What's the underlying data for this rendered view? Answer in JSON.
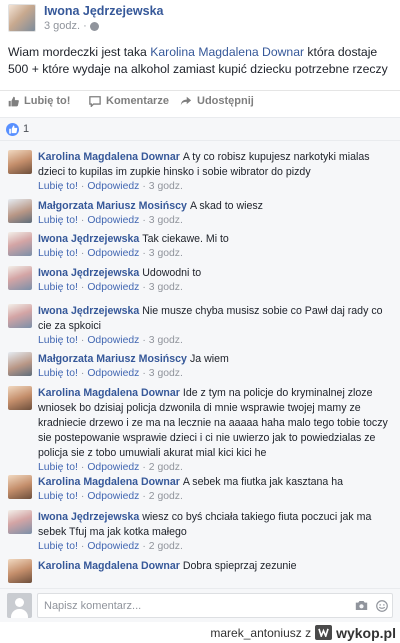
{
  "post": {
    "author": "Iwona Jędrzejewska",
    "time": "3 godz.",
    "text_before": "Wiam mordeczki jest taka ",
    "mention": "Karolina Magdalena Downar",
    "text_after": " która dostaje 500 + które wydaje na alkohol zamiast kupić dziecku potrzebne rzeczy"
  },
  "actions": {
    "like": "Lubię to!",
    "comment": "Komentarze",
    "share": "Udostępnij"
  },
  "reactions": {
    "count": "1"
  },
  "comments": [
    {
      "author": "Karolina Magdalena Downar",
      "text": "A ty co robisz kupujesz narkotyki mialas dzieci to kupilas im zupkie hinsko i sobie wibrator do pizdy",
      "like": "Lubię to!",
      "reply": "Odpowiedz",
      "time": "3 godz."
    },
    {
      "author": "Małgorzata Mariusz Mosińscy",
      "text": "A skad to wiesz",
      "like": "Lubię to!",
      "reply": "Odpowiedz",
      "time": "3 godz."
    },
    {
      "author": "Iwona Jędrzejewska",
      "text": "Tak ciekawe. Mi to",
      "like": "Lubię to!",
      "reply": "Odpowiedz",
      "time": "3 godz."
    },
    {
      "author": "Iwona Jędrzejewska",
      "text": "Udowodni to",
      "like": "Lubię to!",
      "reply": "Odpowiedz",
      "time": "3 godz."
    },
    {
      "author": "Iwona Jędrzejewska",
      "text": "Nie musze chyba musisz sobie co Pawł daj rady co cie za spkoici",
      "like": "Lubię to!",
      "reply": "Odpowiedz",
      "time": "3 godz."
    },
    {
      "author": "Małgorzata Mariusz Mosińscy",
      "text": "Ja wiem",
      "like": "Lubię to!",
      "reply": "Odpowiedz",
      "time": "3 godz."
    },
    {
      "author": "Karolina Magdalena Downar",
      "text": "Ide z tym na policje do kryminalnej zloze wniosek bo dzisiaj policja dzwonila di mnie wsprawie twojej mamy ze kradniecie drzewo i ze ma na lecznie na aaaaa haha malo tego tobie toczy sie postepowanie wsprawie dzieci i ci nie uwierzo jak to powiedzialas ze policja sie z tobo umuwiali akurat mial kici kici he",
      "like": "Lubię to!",
      "reply": "Odpowiedz",
      "time": "2 godz."
    },
    {
      "author": "Karolina Magdalena Downar",
      "text": "A sebek ma fiutka jak kasztana ha",
      "like": "Lubię to!",
      "reply": "Odpowiedz",
      "time": "2 godz."
    },
    {
      "author": "Iwona Jędrzejewska",
      "text": "wiesz co byś chciała takiego fiuta poczuci jak ma sebek Tfuj ma jak kotka małego",
      "like": "Lubię to!",
      "reply": "Odpowiedz",
      "time": "2 godz."
    },
    {
      "author": "Karolina Magdalena Downar",
      "text": "Dobra spieprzaj zezunie",
      "like": "Lubię to!",
      "reply": "Odpowiedz",
      "time": "2 godz."
    }
  ],
  "composer": {
    "placeholder": "Napisz komentarz..."
  },
  "watermark": {
    "user": "marek_antoniusz z",
    "brand": "wykop.pl"
  },
  "colors": {
    "link": "#365899",
    "meta": "#90949c",
    "like_badge": "#5890ff",
    "comments_bg": "#f6f7f9"
  }
}
